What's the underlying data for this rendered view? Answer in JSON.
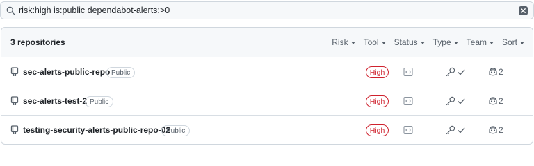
{
  "search": {
    "query": "risk:high is:public dependabot-alerts:>0",
    "icon": "search-icon",
    "clear_icon": "close-icon"
  },
  "header": {
    "count_label": "3 repositories",
    "filters": [
      {
        "label": "Risk"
      },
      {
        "label": "Tool"
      },
      {
        "label": "Status"
      },
      {
        "label": "Type"
      },
      {
        "label": "Team"
      },
      {
        "label": "Sort"
      }
    ]
  },
  "repositories": [
    {
      "name": "sec-alerts-public-repo",
      "visibility": "Public",
      "risk": "High",
      "team_count": "2"
    },
    {
      "name": "sec-alerts-test-2",
      "visibility": "Public",
      "risk": "High",
      "team_count": "2"
    },
    {
      "name": "testing-security-alerts-public-repo-02",
      "visibility": "Public",
      "risk": "High",
      "team_count": "2"
    }
  ],
  "colors": {
    "risk_high": "#cf222e",
    "muted": "#57606a",
    "border": "#d0d7de",
    "header_bg": "#f6f8fa"
  }
}
